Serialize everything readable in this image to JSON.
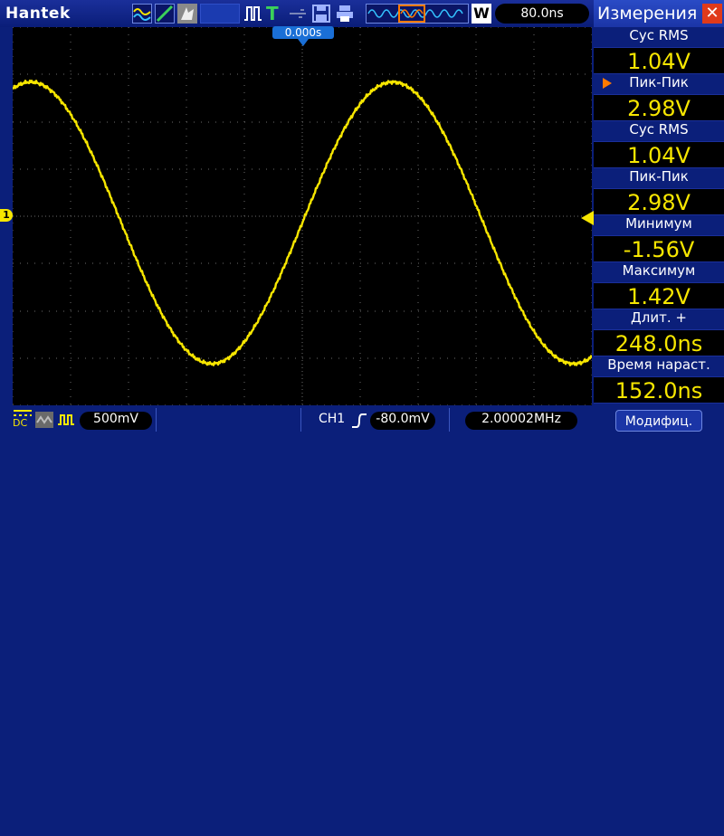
{
  "header": {
    "brand": "Hantek",
    "stop_indicator": "T",
    "zoom_label": "W",
    "timebase": "80.0ns"
  },
  "screen": {
    "trigger_position": "0.000s",
    "channel_marker": "1",
    "waveform_color": "#f7e600",
    "grid_color": "#6b6b6b",
    "background": "#000000"
  },
  "footer": {
    "coupling": "DC",
    "volts_per_div": "500mV",
    "trigger_source": "CH1",
    "trigger_level": "-80.0mV",
    "frequency": "2.00002MHz"
  },
  "panel": {
    "title": "Измерения",
    "close_icon": "close-icon",
    "measurements": [
      {
        "label": "Cyc RMS",
        "value": "1.04V"
      },
      {
        "label": "Пик-Пик",
        "value": "2.98V"
      },
      {
        "label": "Cyc RMS",
        "value": "1.04V"
      },
      {
        "label": "Пик-Пик",
        "value": "2.98V"
      },
      {
        "label": "Минимум",
        "value": "-1.56V"
      },
      {
        "label": "Максимум",
        "value": "1.42V"
      },
      {
        "label": "Длит. +",
        "value": "248.0ns"
      },
      {
        "label": "Время нараст.",
        "value": "152.0ns"
      }
    ],
    "modify_button": "Модифиц."
  },
  "colors": {
    "accent": "#f7e600",
    "chrome": "#0b1f7a",
    "highlight": "#1a6fd6",
    "selection": "#ff7a00",
    "close": "#e03a1a"
  }
}
